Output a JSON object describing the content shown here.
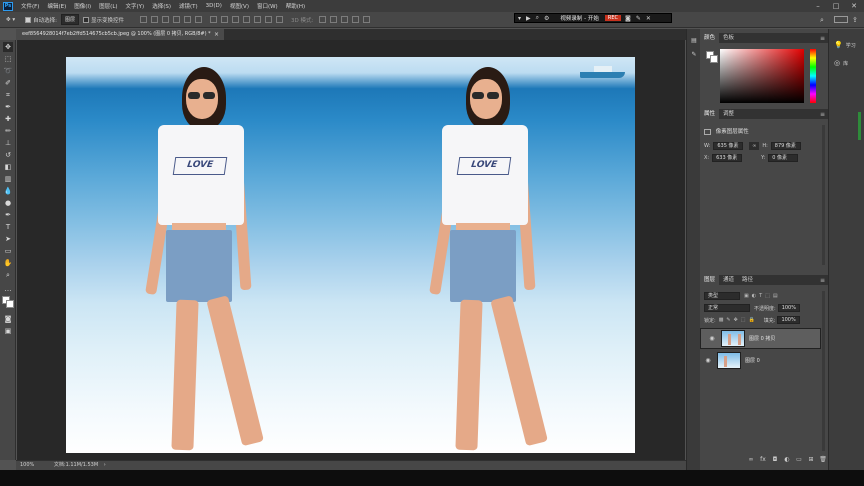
{
  "menubar": {
    "logo": "Ps",
    "items": [
      "文件(F)",
      "编辑(E)",
      "图像(I)",
      "图层(L)",
      "文字(Y)",
      "选择(S)",
      "滤镜(T)",
      "3D(D)",
      "视图(V)",
      "窗口(W)",
      "帮助(H)"
    ],
    "min": "–",
    "max": "□",
    "close": "✕"
  },
  "options": {
    "auto_select_label": "自动选择:",
    "auto_select_value": "图层",
    "transform_label": "显示变换控件",
    "mode_3d_label": "3D 模式:"
  },
  "recorder": {
    "title": "视频录制 - 开始",
    "rec": "REC"
  },
  "document": {
    "tab_title": "eef8564928014f7eb2ffd514675cb5cb.jpeg @ 100% (图层 0 拷贝, RGB/8#) *",
    "close": "×"
  },
  "status": {
    "zoom": "100%",
    "doc_info": "文档:1.11M/1.53M"
  },
  "panels": {
    "color_tabs": [
      "颜色",
      "色板"
    ],
    "properties_tabs": [
      "属性",
      "调整"
    ],
    "pixel_layer_props": "像素图层属性",
    "w_label": "W:",
    "w_value": "635 像素",
    "h_label": "H:",
    "h_value": "879 像素",
    "x_label": "X:",
    "x_value": "633 像素",
    "y_label": "Y:",
    "y_value": "0 像素",
    "link": "∞",
    "layers_tabs": [
      "图层",
      "通道",
      "路径"
    ],
    "filter_value": "类型",
    "blend_mode": "正常",
    "opacity_label": "不透明度:",
    "opacity_value": "100%",
    "lock_label": "锁定:",
    "fill_label": "填充:",
    "fill_value": "100%",
    "layers": [
      {
        "name": "图层 0 拷贝",
        "selected": true
      },
      {
        "name": "图层 0",
        "selected": false
      }
    ],
    "menu": "≡"
  },
  "right_mini": {
    "learn": "学习",
    "library": "库"
  },
  "photo": {
    "shirt_print": "LOVE"
  },
  "colors": {
    "accent_rec": "#c8321e",
    "picker_hue": "#e10000"
  }
}
